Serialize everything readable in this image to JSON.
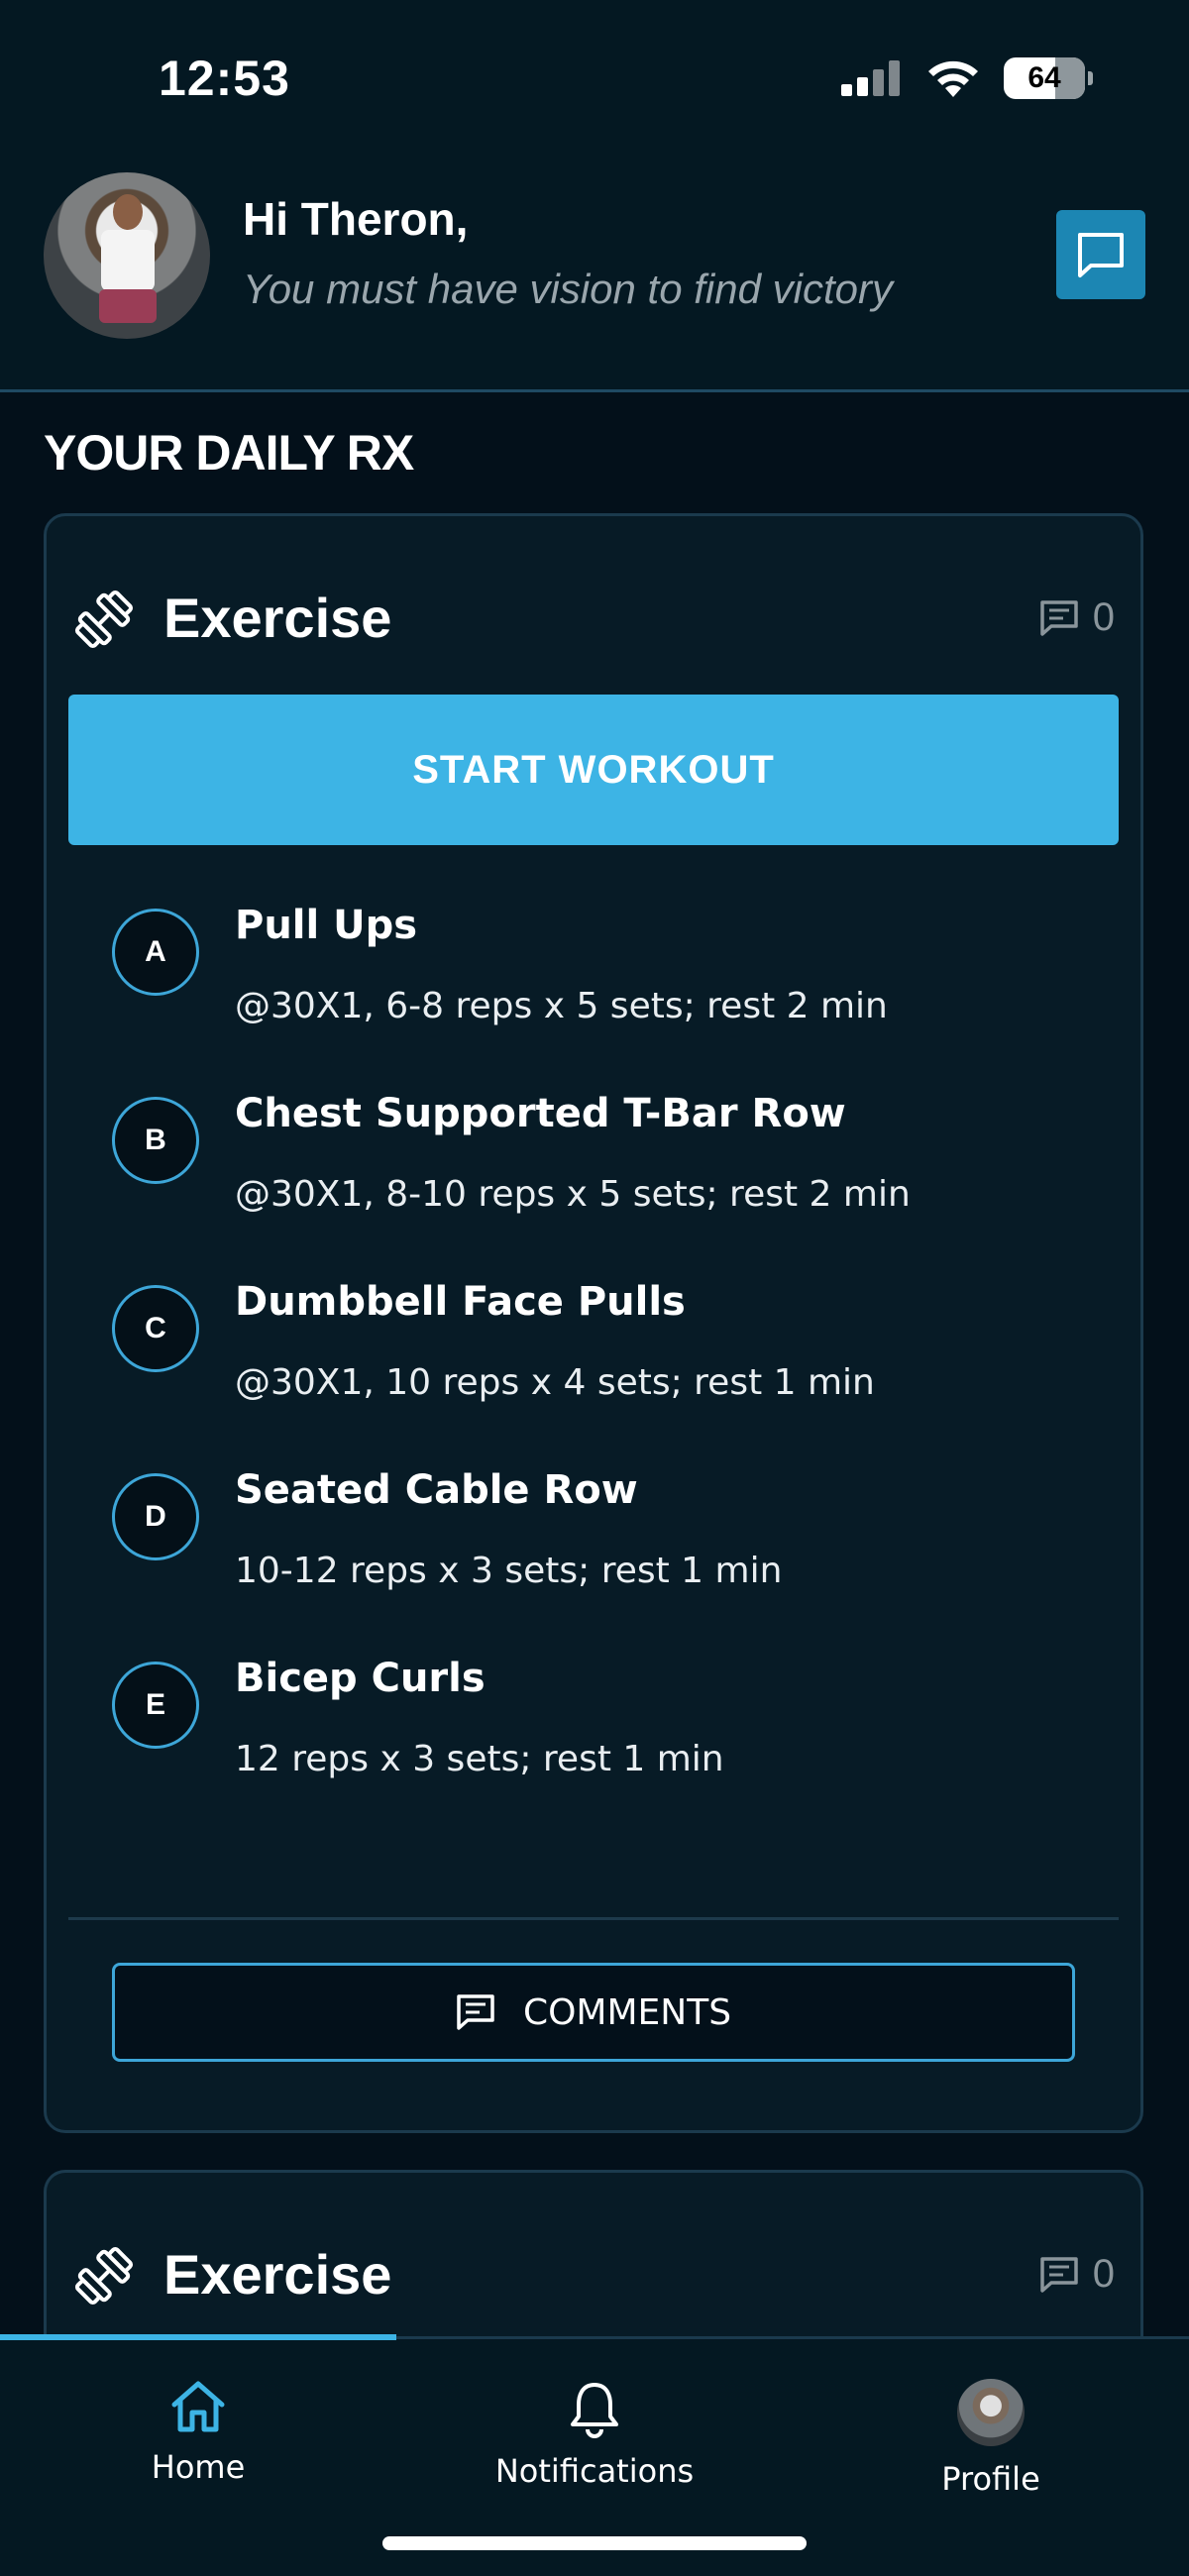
{
  "status_bar": {
    "time": "12:53",
    "battery": "64"
  },
  "header": {
    "greeting": "Hi Theron,",
    "quote": "You must have vision to find victory"
  },
  "section_title": "YOUR DAILY RX",
  "card1": {
    "title": "Exercise",
    "comment_count": "0",
    "start_label": "START WORKOUT",
    "exercises": [
      {
        "letter": "A",
        "name": "Pull Ups",
        "detail": "@30X1, 6-8 reps x 5 sets; rest 2 min"
      },
      {
        "letter": "B",
        "name": "Chest Supported T-Bar Row",
        "detail": "@30X1, 8-10 reps x 5 sets; rest 2 min"
      },
      {
        "letter": "C",
        "name": "Dumbbell Face Pulls",
        "detail": "@30X1, 10 reps x 4 sets; rest 1 min"
      },
      {
        "letter": "D",
        "name": "Seated Cable Row",
        "detail": "10-12 reps x 3 sets; rest 1 min"
      },
      {
        "letter": "E",
        "name": "Bicep Curls",
        "detail": "12 reps x 3 sets; rest 1 min"
      }
    ],
    "comments_label": "COMMENTS"
  },
  "card2": {
    "title": "Exercise",
    "comment_count": "0"
  },
  "tabs": {
    "home": "Home",
    "notifications": "Notifications",
    "profile": "Profile"
  },
  "colors": {
    "background": "#03101a",
    "header": "#041822",
    "accent": "#3db4e5",
    "chat_button": "#1c86b3",
    "badge_border": "#3da6d8"
  }
}
